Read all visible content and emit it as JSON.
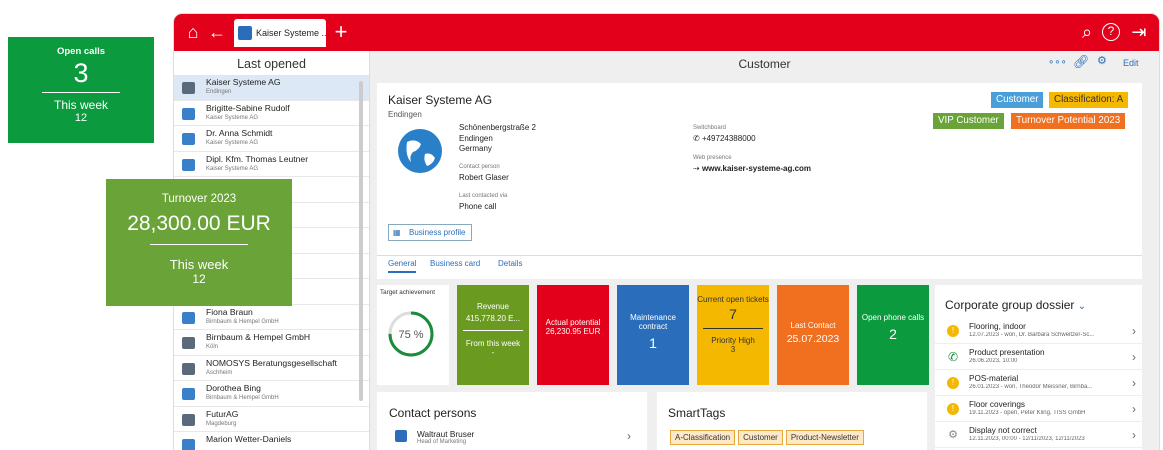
{
  "tab": {
    "label": "Kaiser Systeme ..."
  },
  "left": {
    "title": "Last opened",
    "items": [
      {
        "name": "Kaiser Systeme AG",
        "sub": "Endingen",
        "type": "company"
      },
      {
        "name": "Brigitte-Sabine Rudolf",
        "sub": "Kaiser Systeme AG",
        "type": "person"
      },
      {
        "name": "Dr. Anna Schmidt",
        "sub": "Kaiser Systeme AG",
        "type": "person"
      },
      {
        "name": "Dipl. Kfm. Thomas Leutner",
        "sub": "Kaiser Systeme AG",
        "type": "person"
      },
      {
        "name": "",
        "sub": "",
        "type": "blank"
      },
      {
        "name": "",
        "sub": "",
        "type": "blank"
      },
      {
        "name": "",
        "sub": "",
        "type": "blank"
      },
      {
        "name": "",
        "sub": "",
        "type": "blank"
      },
      {
        "name": "",
        "sub": "",
        "type": "blank"
      },
      {
        "name": "Fiona Braun",
        "sub": "Birnbaum & Hempel GmbH",
        "type": "person"
      },
      {
        "name": "Birnbaum & Hempel GmbH",
        "sub": "Köln",
        "type": "company"
      },
      {
        "name": "NOMOSYS Beratungsgesellschaft",
        "sub": "Aschheim",
        "type": "company"
      },
      {
        "name": "Dorothea Bing",
        "sub": "Birnbaum & Hempel GmbH",
        "type": "person"
      },
      {
        "name": "FuturAG",
        "sub": "Magdeburg",
        "type": "company"
      },
      {
        "name": "Marion Wetter-Daniels",
        "sub": "",
        "type": "person"
      }
    ]
  },
  "main": {
    "title": "Customer",
    "edit": "Edit",
    "company": "Kaiser Systeme AG",
    "city": "Endingen",
    "address": [
      "Schönenbergstraße 2",
      "Endingen",
      "Germany"
    ],
    "contact_label": "Contact person",
    "contact": "Robert Glaser",
    "last_label": "Last contacted via",
    "last": "Phone call",
    "switchboard_label": "Switchboard",
    "switchboard": "+49724388000",
    "web_label": "Web presence",
    "web": "www.kaiser-systeme-ag.com",
    "business_profile": "Business profile",
    "badges": {
      "customer": "Customer",
      "classification": "Classification: A",
      "vip": "VIP Customer",
      "turnover": "Turnover Potential 2023"
    },
    "tabs": [
      "General",
      "Business card",
      "Details"
    ],
    "target_label": "Target achievement",
    "target_value": "75 %",
    "target_fraction": 0.75,
    "tiles": {
      "revenue": {
        "title": "Revenue",
        "value": "415,778.20 E...",
        "sub": "From this week",
        "subval": "-"
      },
      "potential": {
        "title": "Actual potential",
        "value": "26,230.95 EUR"
      },
      "maintenance": {
        "title": "Maintenance contract",
        "value": "1"
      },
      "tickets": {
        "title": "Current open tickets",
        "value": "7",
        "sub": "Priority High",
        "subval": "3"
      },
      "lastcontact": {
        "title": "Last Contact",
        "value": "25.07.2023"
      },
      "phone": {
        "title": "Open phone calls",
        "value": "2"
      }
    },
    "contacts_title": "Contact persons",
    "contact_person": {
      "name": "Waltraut Bruser",
      "role": "Head of Marketing"
    },
    "smarttags_title": "SmartTags",
    "tags": [
      "A-Classification",
      "Customer",
      "Product-Newsletter"
    ],
    "dossier_title": "Corporate group dossier",
    "dossier": [
      {
        "title": "Flooring, indoor",
        "sub": "12.07.2023 - won, Dr. Barbara Schweitzer-Sc...",
        "icon": "coin"
      },
      {
        "title": "Product presentation",
        "sub": "26.06.2023, 10:00",
        "icon": "phone"
      },
      {
        "title": "POS-material",
        "sub": "26.01.2023 - won, Theodor Meissner, Birnba...",
        "icon": "coin"
      },
      {
        "title": "Floor coverings",
        "sub": "19.11.2023 - open, Peter Kling, TISS GmbH",
        "icon": "coin"
      },
      {
        "title": "Display not correct",
        "sub": "12.11.2023, 00:00 - 12/11/2023, 12/11/2023",
        "icon": "gear"
      }
    ]
  },
  "overlay1": {
    "title": "Open calls",
    "value": "3",
    "sub": "This week",
    "subval": "12"
  },
  "overlay2": {
    "title": "Turnover 2023",
    "value": "28,300.00 EUR",
    "sub": "This week",
    "subval": "12"
  },
  "colors": {
    "red": "#e2001a",
    "blue": "#4a9fd8",
    "orange": "#f5a623"
  }
}
